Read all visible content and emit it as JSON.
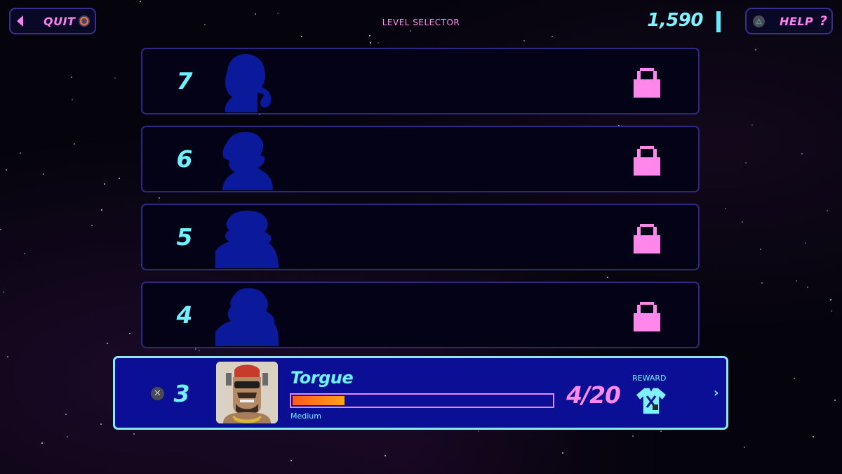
{
  "topbar": {
    "quit_label": "QUIT",
    "title": "LEVEL SELECTOR",
    "score": "1,590",
    "help_label": "HELP",
    "help_glyph": "?"
  },
  "levels": [
    {
      "number": "7",
      "status": "locked",
      "icon": "lock-icon"
    },
    {
      "number": "6",
      "status": "locked",
      "icon": "lock-icon"
    },
    {
      "number": "5",
      "status": "locked",
      "icon": "lock-icon"
    },
    {
      "number": "4",
      "status": "locked",
      "icon": "lock-icon"
    }
  ],
  "current_level": {
    "number": "3",
    "boss_name": "Torgue",
    "difficulty": "Medium",
    "progress_text": "4/20",
    "progress_fraction": 0.2,
    "reward_label": "REWARD",
    "reward_icon": "shirt-reward-icon"
  },
  "colors": {
    "accent_pink": "#ff7ef0",
    "accent_cyan": "#6ef2ff",
    "active_row_bg": "#0a0f96",
    "silhouette": "#0a1a9a",
    "progress_fill": "#ff7a1a"
  }
}
